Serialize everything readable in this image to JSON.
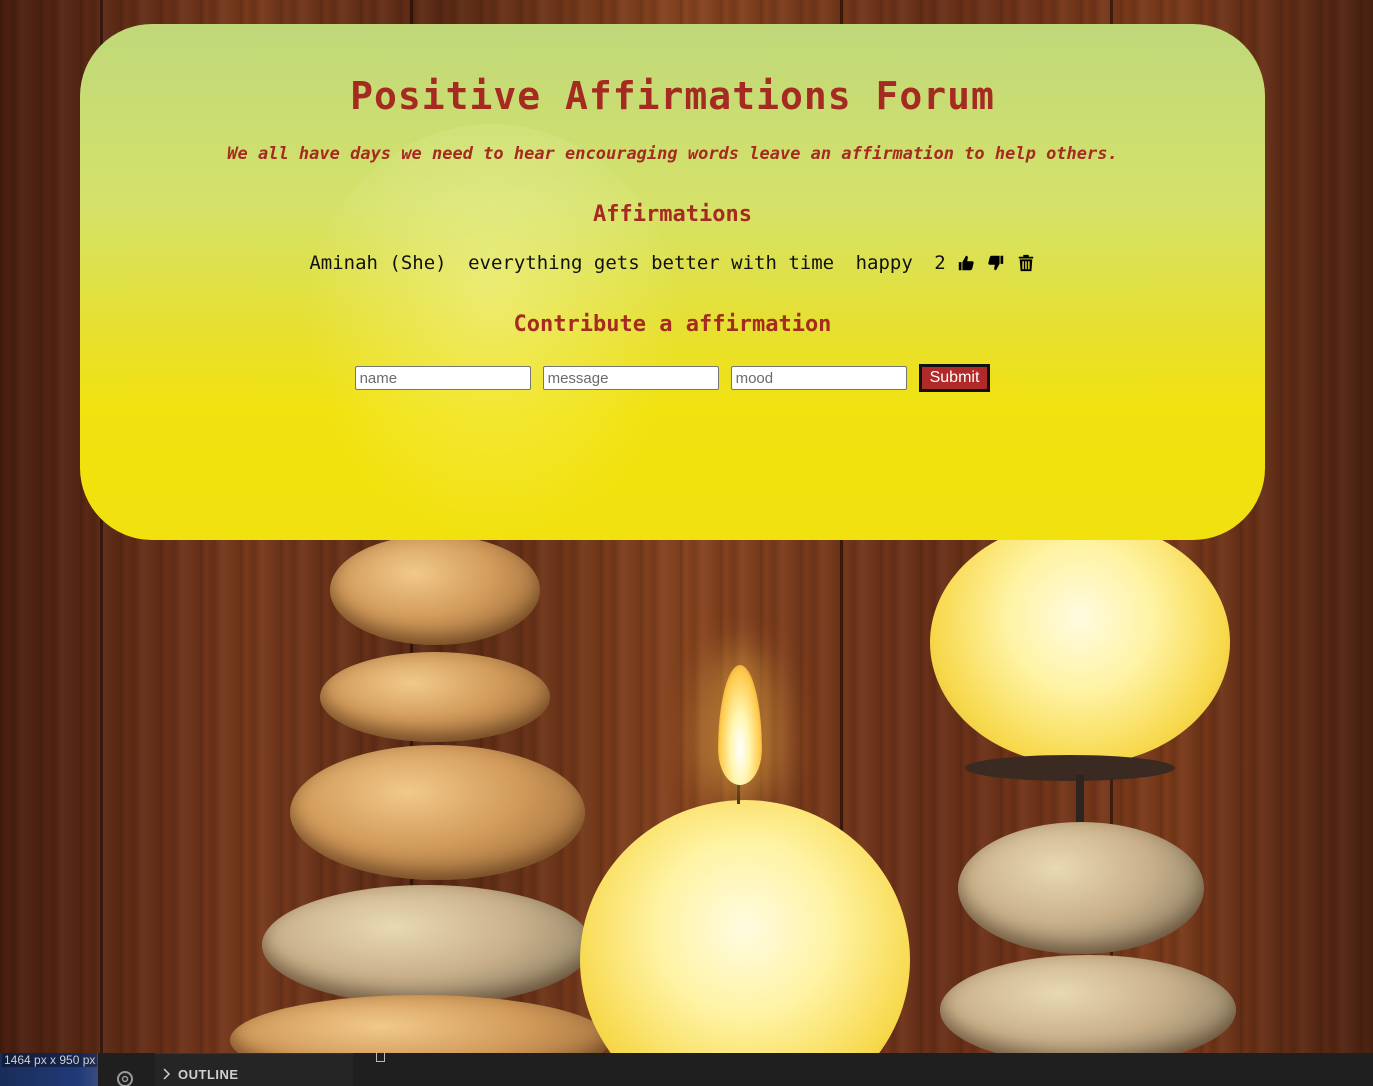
{
  "header": {
    "title": "Positive Affirmations Forum",
    "subtitle": "We all have days we need to hear encouraging words leave an affirmation to help others."
  },
  "affirmations": {
    "heading": "Affirmations",
    "items": [
      {
        "name": "Aminah (She)",
        "message": "everything gets better with time",
        "mood": "happy",
        "likes": "2",
        "actions": [
          "thumbs-up-icon",
          "thumbs-down-icon",
          "trash-icon"
        ]
      }
    ]
  },
  "form": {
    "heading": "Contribute a affirmation",
    "name_placeholder": "name",
    "message_placeholder": "message",
    "mood_placeholder": "mood",
    "submit_label": "Submit"
  },
  "editor_bar": {
    "dimensions": "1464 px x 950 px",
    "outline_label": "OUTLINE"
  },
  "colors": {
    "heading": "#a52a22",
    "card_top": "#bfd87a",
    "card_bottom": "#f1e10e",
    "submit_bg": "#b02a2a"
  }
}
